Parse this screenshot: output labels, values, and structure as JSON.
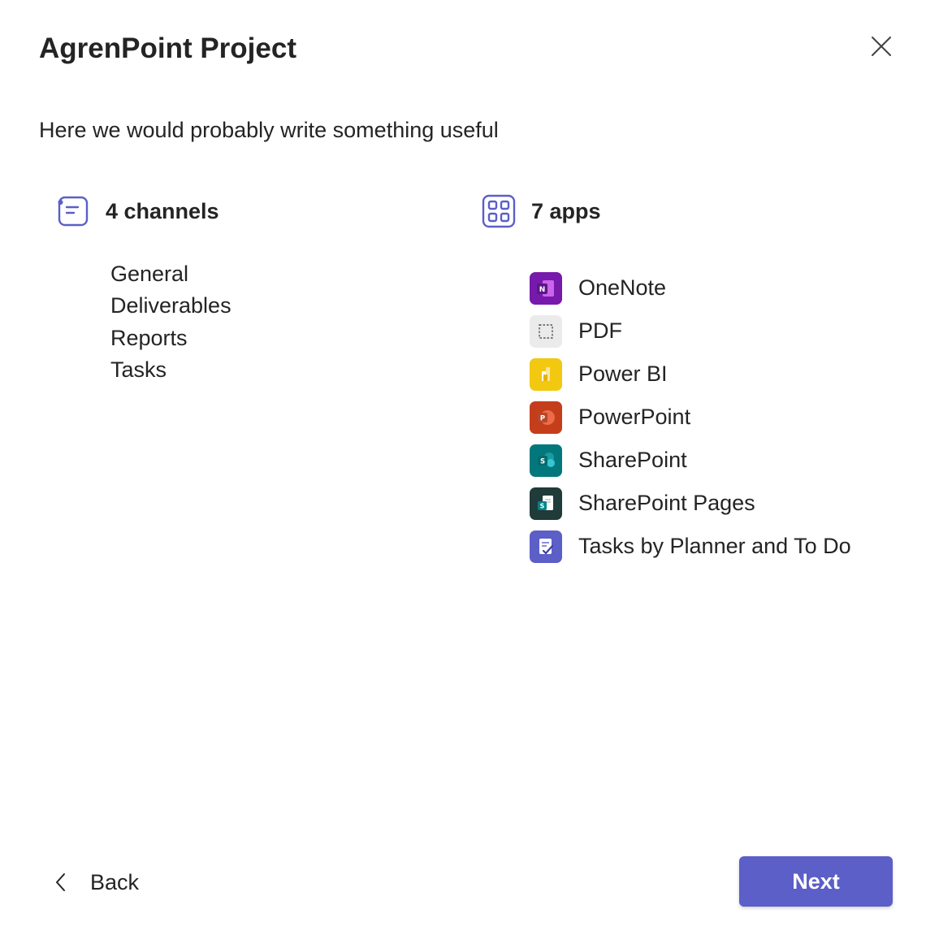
{
  "dialog": {
    "title": "AgrenPoint Project",
    "description": "Here we would probably write something useful"
  },
  "channels": {
    "heading": "4 channels",
    "icon": "channel-list-icon",
    "items": [
      "General",
      "Deliverables",
      "Reports",
      "Tasks"
    ]
  },
  "apps": {
    "heading": "7 apps",
    "icon": "apps-grid-icon",
    "items": [
      {
        "label": "OneNote",
        "icon": "onenote-icon",
        "color": "#7719aa"
      },
      {
        "label": "PDF",
        "icon": "pdf-icon",
        "color": "#ebebeb"
      },
      {
        "label": "Power BI",
        "icon": "power-bi-icon",
        "color": "#f2c811"
      },
      {
        "label": "PowerPoint",
        "icon": "powerpoint-icon",
        "color": "#c43e1c"
      },
      {
        "label": "SharePoint",
        "icon": "sharepoint-icon",
        "color": "#03787c"
      },
      {
        "label": "SharePoint Pages",
        "icon": "sharepoint-pages-icon",
        "color": "#1f3b3a"
      },
      {
        "label": "Tasks by Planner and To Do",
        "icon": "planner-icon",
        "color": "#5b5fc7"
      }
    ]
  },
  "footer": {
    "back_label": "Back",
    "next_label": "Next"
  },
  "colors": {
    "accent": "#5b5fc7",
    "text": "#242424"
  }
}
